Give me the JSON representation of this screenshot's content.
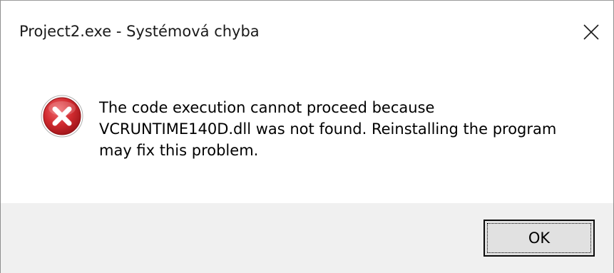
{
  "window": {
    "title": "Project2.exe - Systémová chyba"
  },
  "icons": {
    "close": "close-icon",
    "error": "error-icon"
  },
  "colors": {
    "error_red": "#c8262b",
    "footer_bg": "#f0f0f0",
    "button_bg": "#e1e1e1"
  },
  "message": {
    "lines": [
      "The code execution cannot proceed because",
      "VCRUNTIME140D.dll was not found. Reinstalling the program",
      "may fix this problem."
    ]
  },
  "buttons": {
    "ok_label": "OK"
  }
}
